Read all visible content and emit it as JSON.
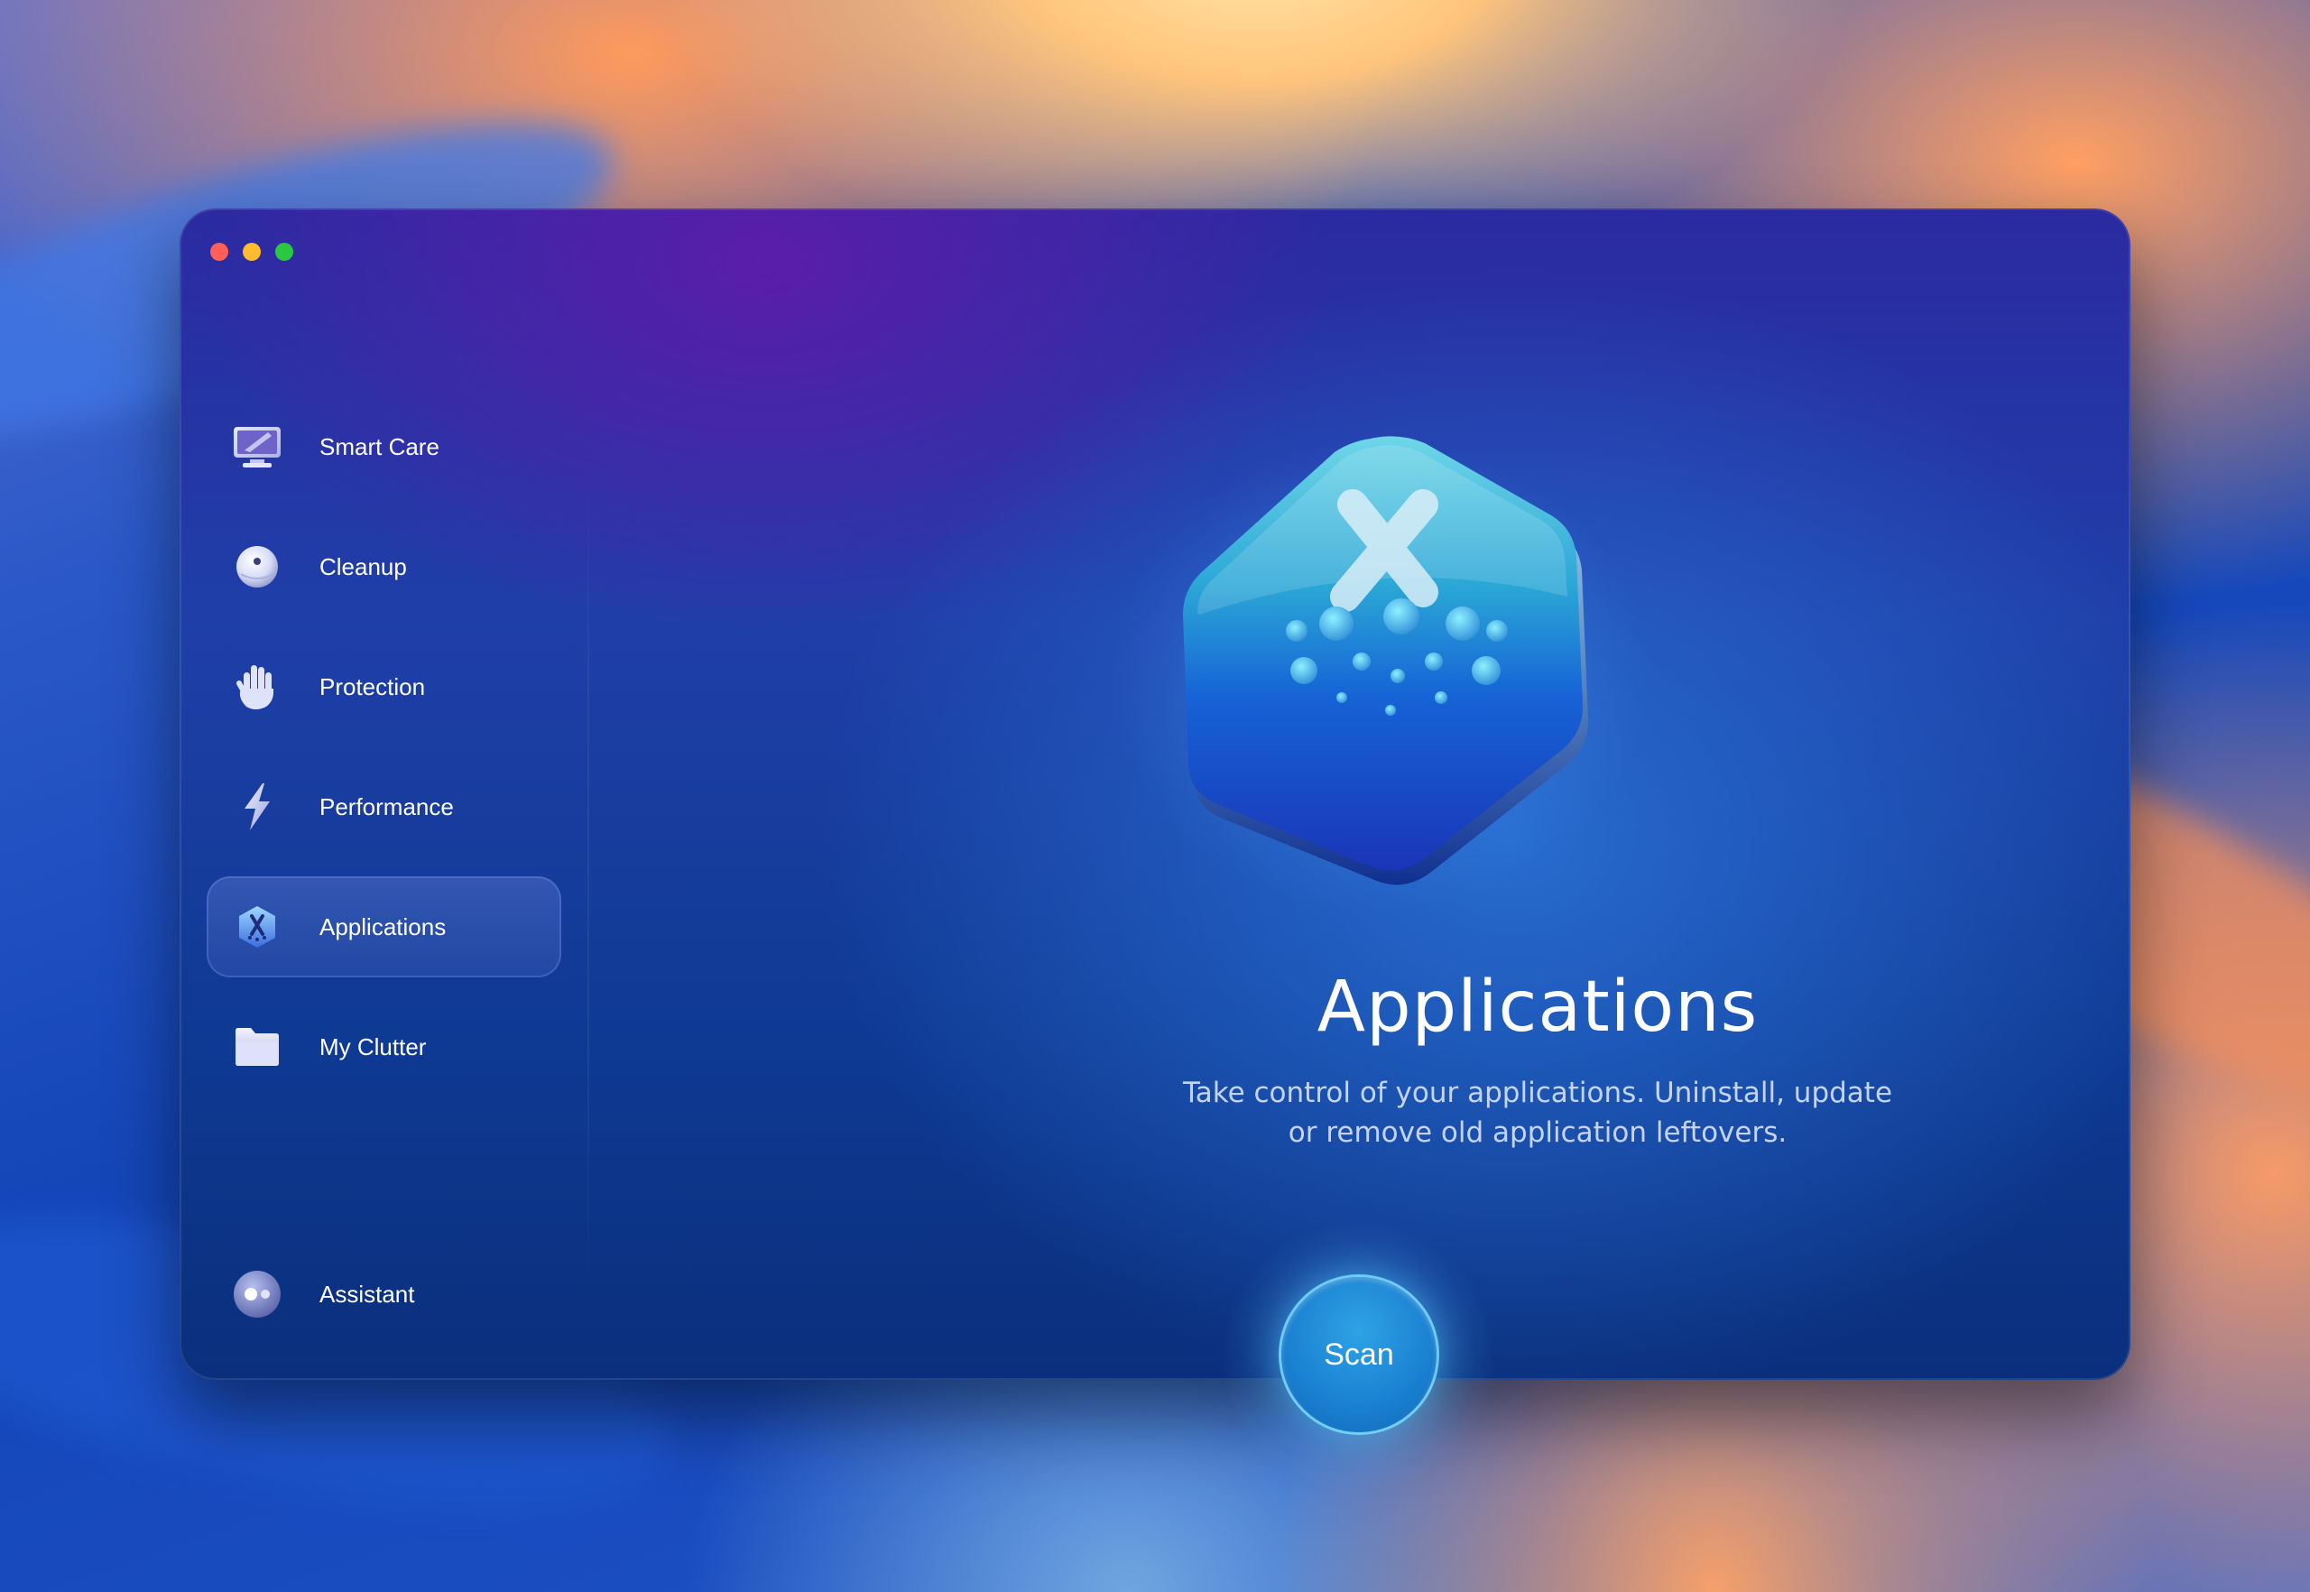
{
  "window": {
    "traffic_lights": {
      "close_color": "#ff5f57",
      "minimize_color": "#febc2e",
      "zoom_color": "#28c840"
    }
  },
  "sidebar": {
    "items": [
      {
        "label": "Smart Care",
        "icon": "display-icon",
        "active": false
      },
      {
        "label": "Cleanup",
        "icon": "cleanup-sphere-icon",
        "active": false
      },
      {
        "label": "Protection",
        "icon": "hand-icon",
        "active": false
      },
      {
        "label": "Performance",
        "icon": "lightning-icon",
        "active": false
      },
      {
        "label": "Applications",
        "icon": "applications-hexagon-icon",
        "active": true
      },
      {
        "label": "My Clutter",
        "icon": "folder-icon",
        "active": false
      }
    ],
    "assistant": {
      "label": "Assistant",
      "icon": "assistant-icon"
    }
  },
  "main": {
    "icon": "applications-hexagon-icon",
    "title": "Applications",
    "description_line1": "Take control of your applications. Uninstall, update",
    "description_line2": "or remove old application leftovers.",
    "scan_label": "Scan"
  },
  "colors": {
    "accent": "#1a7fd0",
    "active_item_bg": "#5a78d0"
  }
}
